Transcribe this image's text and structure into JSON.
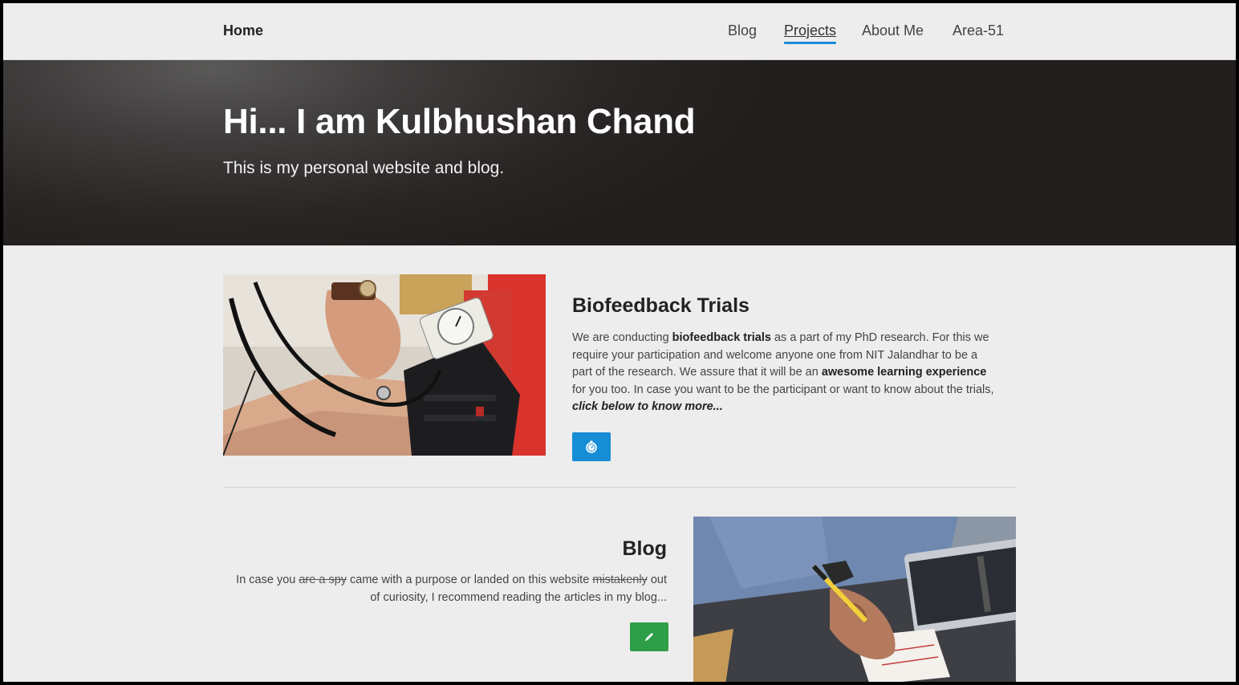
{
  "navbar": {
    "brand": "Home",
    "links": [
      {
        "label": "Blog",
        "active": false
      },
      {
        "label": "Projects",
        "active": true
      },
      {
        "label": "About Me",
        "active": false
      },
      {
        "label": "Area-51",
        "active": false
      }
    ]
  },
  "hero": {
    "title": "Hi... I am Kulbhushan Chand",
    "subtitle": "This is my personal website and blog."
  },
  "biofeedback": {
    "title": "Biofeedback Trials",
    "text_1": "We are conducting ",
    "bold_1": "biofeedback trials",
    "text_2": " as a part of my PhD research. For this we require your participation and welcome anyone one from NIT Jalandhar to be a part of the research. We assure that it will be an ",
    "bold_2": "awesome learning experience",
    "text_3": " for you too. In case you want to be the participant or want to know about the trials, ",
    "bold_italic": "click below to know more...",
    "button_icon": "stopwatch-icon",
    "button_color": "#178dd6",
    "image": "blood-pressure-measurement-photo"
  },
  "blog": {
    "title": "Blog",
    "text_1": "In case you ",
    "strike_1": "are a spy",
    "text_2": " came with a purpose or landed on this website ",
    "strike_2": "mistakenly",
    "text_3": " out of curiosity, I recommend reading the articles in my blog...",
    "button_icon": "pencil-icon",
    "button_color": "#2e9e49",
    "image": "person-writing-notes-photo"
  },
  "colors": {
    "accent": "#1a8cd8",
    "page_bg": "#ededed",
    "hero_bg": "#2a2625"
  }
}
